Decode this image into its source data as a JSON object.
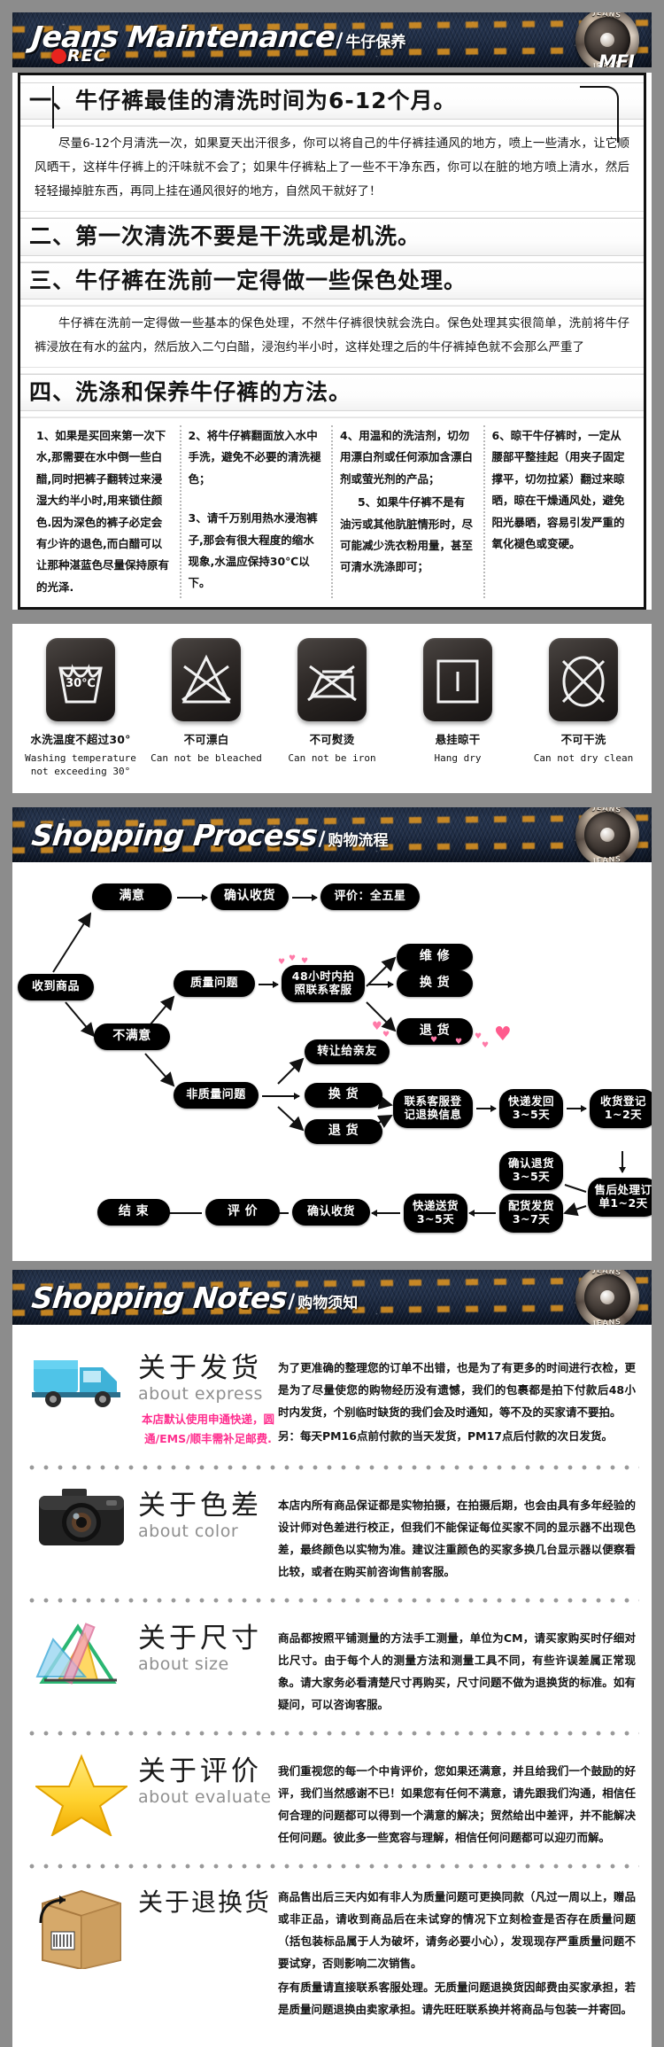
{
  "banners": {
    "maintenance": {
      "en": "Jeans Maintenance",
      "slash": "/",
      "cn": "牛仔保养",
      "rec": "REC",
      "button_top": "JEANS",
      "button_bottom": "JEANS",
      "mfi": "MFI"
    },
    "process": {
      "en": "Shopping Process",
      "slash": "/",
      "cn": "购物流程",
      "button_top": "JEANS",
      "button_bottom": "JEANS"
    },
    "notes": {
      "en": "Shopping Notes",
      "slash": "/",
      "cn": "购物须知",
      "button_top": "JEANS",
      "button_bottom": "JEANS"
    }
  },
  "maintenance": {
    "sections": [
      {
        "heading": "一、牛仔裤最佳的清洗时间为6-12个月。",
        "body": "尽量6-12个月清洗一次，如果夏天出汗很多，你可以将自己的牛仔裤挂通风的地方，喷上一些清水，让它顺风晒干，这样牛仔裤上的汗味就不会了；如果牛仔裤粘上了一些不干净东西，你可以在脏的地方喷上清水，然后轻轻撮掉脏东西，再同上挂在通风很好的地方，自然风干就好了！"
      },
      {
        "heading": "二、第一次清洗不要是干洗或是机洗。",
        "body": ""
      },
      {
        "heading": "三、牛仔裤在洗前一定得做一些保色处理。",
        "body": "牛仔裤在洗前一定得做一些基本的保色处理，不然牛仔裤很快就会洗白。保色处理其实很简单，洗前将牛仔裤浸放在有水的盆内，然后放入二勺白醋，浸泡约半小时，这样处理之后的牛仔裤掉色就不会那么严重了"
      },
      {
        "heading": "四、洗涤和保养牛仔裤的方法。",
        "body": ""
      }
    ],
    "methods": [
      [
        "1、如果是买回来第一次下水,那需要在水中倒一些白醋,同时把裤子翻转过来浸湿大约半小时,用来锁住颜色.因为深色的裤子必定会有少许的退色,而白醋可以让那种湛蓝色尽量保持原有的光泽."
      ],
      [
        "2、将牛仔裤翻面放入水中手洗，避免不必要的清洗褪色；",
        "3、请千万别用热水浸泡裤子,那会有很大程度的缩水现象,水温应保持30℃以下。"
      ],
      [
        "4、用温和的洗洁剂，切勿用漂白剂或任何添加含漂白剂或萤光剂的产品；",
        "5、如果牛仔裤不是有油污或其他肮脏情形时，尽可能减少洗衣粉用量，甚至可清水洗涤即可；"
      ],
      [
        "6、晾干牛仔裤时，一定从腰部平整挂起（用夹子固定撑平，切勿拉紧）翻过来晾晒，晾在干燥通风处，避免阳光暴晒，容易引发严重的氧化褪色或变硬。"
      ]
    ]
  },
  "care_symbols": [
    {
      "icon": "wash-tub-30-icon",
      "temp": "30℃",
      "cn": "水洗温度不超过30°",
      "en": "Washing temperature not exceeding 30°"
    },
    {
      "icon": "no-bleach-icon",
      "temp": "",
      "cn": "不可漂白",
      "en": "Can not be bleached"
    },
    {
      "icon": "no-iron-icon",
      "temp": "",
      "cn": "不可熨烫",
      "en": "Can not be iron"
    },
    {
      "icon": "hang-dry-icon",
      "temp": "",
      "cn": "悬挂晾干",
      "en": "Hang dry"
    },
    {
      "icon": "no-dry-clean-icon",
      "temp": "",
      "cn": "不可干洗",
      "en": "Can not dry clean"
    }
  ],
  "flowchart": {
    "nodes": {
      "received": "收到商品",
      "satisfied": "满意",
      "confirm_receipt_top": "确认收货",
      "rate_five_star": "评价：全五星",
      "unsatisfied": "不满意",
      "quality_issue": "质量问题",
      "photo_contact": "48小时内拍照联系客服",
      "repair": "维 修",
      "exchange_top": "换 货",
      "return_top": "退 货",
      "non_quality_issue": "非质量问题",
      "transfer": "转让给亲友",
      "exchange_mid": "换 货",
      "return_mid": "退 货",
      "contact_register": "联系客服登记退换信息",
      "express_back": "快递发回3~5天",
      "receipt_register": "收货登记1~2天",
      "confirm_return": "确认退货3~5天",
      "after_sales": "售后处理订单1~2天",
      "ship_out": "配货发货3~7天",
      "delivery": "快递送货3~5天",
      "confirm_receipt_bottom": "确认收货",
      "evaluate": "评 价",
      "end": "结 束"
    }
  },
  "notes": [
    {
      "icon": "truck-icon",
      "cn": "关于发货",
      "en": "about express",
      "extra": "本店默认使用申通快递，圆通/EMS/顺丰需补足邮费.",
      "paras": [
        "为了更准确的整理您的订单不出错，也是为了有更多的时间进行衣检，更是为了尽量使您的购物经历没有遗憾，我们的包裹都是拍下付款后48小时内发货，个别临时缺货的我们会及时通知，等不及的买家请不要拍。",
        "另：每天PM16点前付款的当天发货，PM17点后付款的次日发货。"
      ]
    },
    {
      "icon": "camera-icon",
      "cn": "关于色差",
      "en": "about color",
      "extra": "",
      "paras": [
        "本店内所有商品保证都是实物拍摄，在拍摄后期，也会由具有多年经验的设计师对色差进行校正，但我们不能保证每位买家不同的显示器不出现色差，最终颜色以实物为准。建议注重颜色的买家多换几台显示器以便察看比较，或者在购买前咨询售前客服。"
      ]
    },
    {
      "icon": "rulers-icon",
      "cn": "关于尺寸",
      "en": "about size",
      "extra": "",
      "paras": [
        "商品都按照平铺测量的方法手工测量，单位为CM，请买家购买时仔细对比尺寸。由于每个人的测量方法和测量工具不同，有些许误差属正常现象。请大家务必看清楚尺寸再购买，尺寸问题不做为退换货的标准。如有疑问，可以咨询客服。"
      ]
    },
    {
      "icon": "star-icon",
      "cn": "关于评价",
      "en": "about evaluate",
      "extra": "",
      "paras": [
        "我们重视您的每一个中肯评价，您如果还满意，并且给我们一个鼓励的好评，我们当然感谢不已！如果您有任何不满意，请先跟我们沟通，相信任何合理的问题都可以得到一个满意的解决；贸然给出中差评，并不能解决任何问题。彼此多一些宽容与理解，相信任何问题都可以迎刃而解。"
      ]
    },
    {
      "icon": "box-icon",
      "cn": "关于退换货",
      "en": "",
      "extra": "",
      "paras": [
        "商品售出后三天内如有非人为质量问题可更换同款（凡过一周以上，赠品或非正品，请收到商品后在未试穿的情况下立刻检查是否存在质量问题（括包装标品属于人为破坏，请务必要小心），发现现存严重质量问题不要试穿，否则影响二次销售。",
        "存有质量请直接联系客服处理。无质量问题退换货因邮费由买家承担，若是质量问题退换由卖家承担。请先旺旺联系换并将商品与包装一并寄回。"
      ]
    }
  ]
}
